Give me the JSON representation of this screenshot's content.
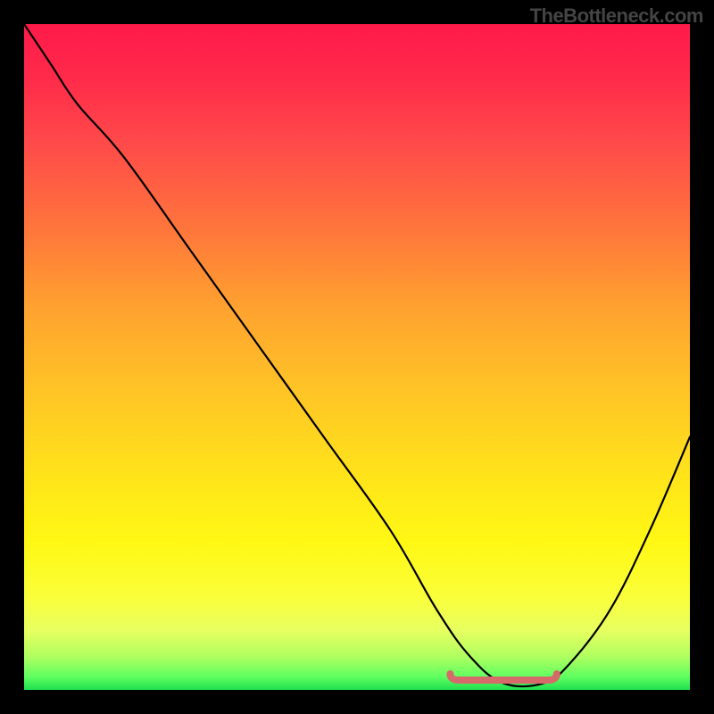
{
  "watermark": "TheBottleneck.com",
  "chart_data": {
    "type": "line",
    "title": "",
    "xlabel": "",
    "ylabel": "",
    "xlim": [
      0,
      100
    ],
    "ylim": [
      0,
      100
    ],
    "grid": false,
    "legend": false,
    "background": "rainbow-gradient-red-to-green-vertical",
    "series": [
      {
        "name": "bottleneck-curve",
        "x": [
          0,
          4,
          8,
          15,
          25,
          35,
          45,
          55,
          62,
          67,
          72,
          78,
          82,
          88,
          94,
          100
        ],
        "y": [
          100,
          94,
          88,
          80,
          66,
          52,
          38,
          24,
          12,
          5,
          1,
          1,
          4,
          12,
          24,
          38
        ]
      }
    ],
    "optimal_range_x": [
      64,
      80
    ],
    "annotations": []
  },
  "colors": {
    "background": "#000000",
    "curve": "#000000",
    "marker": "#d66a6a",
    "watermark": "#444444"
  }
}
